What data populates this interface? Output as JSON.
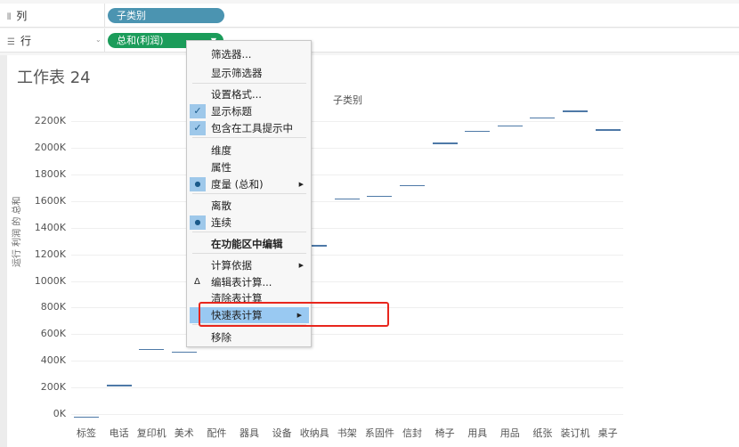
{
  "shelves": {
    "columns": {
      "label": "列",
      "pill": "子类别"
    },
    "rows": {
      "label": "行",
      "pill": "总和(利润)"
    }
  },
  "sheet": {
    "title": "工作表 24",
    "x_header": "子类别",
    "y_label": "运行 利润 的 总和"
  },
  "chart_data": {
    "type": "bar",
    "title": "",
    "xlabel": "子类别",
    "ylabel": "运行 利润 的 总和",
    "y_ticks": [
      "0K",
      "200K",
      "400K",
      "600K",
      "800K",
      "1000K",
      "1200K",
      "1400K",
      "1600K",
      "1800K",
      "2000K",
      "2200K"
    ],
    "ylim": [
      0,
      2300
    ],
    "categories": [
      "标签",
      "电话",
      "复印机",
      "美术",
      "配件",
      "器具",
      "设备",
      "收纳具",
      "书架",
      "系固件",
      "信封",
      "椅子",
      "用具",
      "用品",
      "纸张",
      "装订机",
      "桌子"
    ],
    "values": [
      -20,
      220,
      490,
      470,
      null,
      null,
      null,
      1270,
      1620,
      1640,
      1720,
      2040,
      2130,
      2170,
      2230,
      2280,
      2140
    ],
    "grid": true,
    "mark": "gantt-line"
  },
  "context_menu": {
    "items": [
      {
        "label": "筛选器..."
      },
      {
        "label": "显示筛选器"
      },
      {
        "label": "设置格式..."
      },
      {
        "label": "显示标题",
        "checked": true
      },
      {
        "label": "包含在工具提示中",
        "checked": true
      },
      {
        "label": "维度"
      },
      {
        "label": "属性"
      },
      {
        "label": "度量 (总和)",
        "bullet": true,
        "submenu": true
      },
      {
        "label": "离散"
      },
      {
        "label": "连续",
        "bullet": true
      },
      {
        "label": "在功能区中编辑",
        "bold": true
      },
      {
        "label": "计算依据",
        "submenu": true
      },
      {
        "label": "编辑表计算...",
        "delta": true
      },
      {
        "label": "清除表计算"
      },
      {
        "label": "快速表计算",
        "highlighted": true,
        "submenu": true
      },
      {
        "label": "移除"
      }
    ]
  },
  "colors": {
    "bar": "#4e79a7",
    "pill_dimension": "#4b94b1",
    "pill_measure": "#1b9c5a",
    "highlight": "#e8261d"
  }
}
